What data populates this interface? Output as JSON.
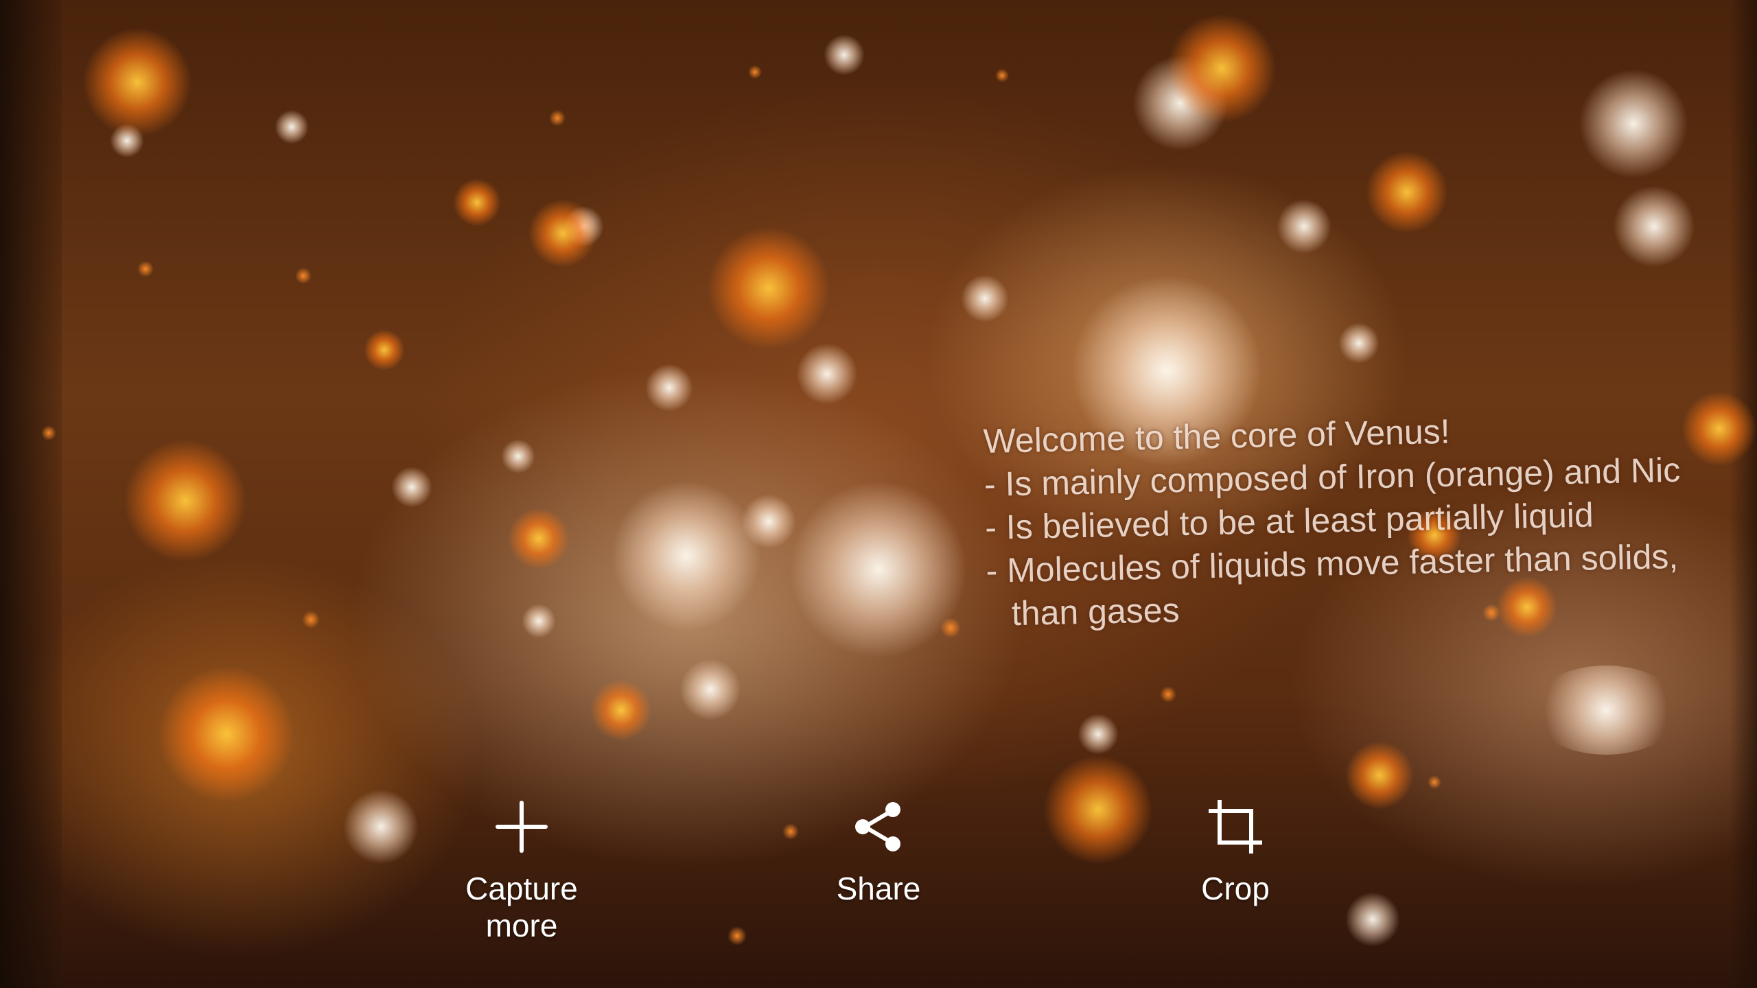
{
  "overlay": {
    "lines": [
      "Welcome to the core of Venus!",
      "- Is mainly composed of Iron (orange) and Nic",
      "- Is believed to be at least partially liquid",
      "- Molecules of liquids move faster than solids,",
      "than gases"
    ]
  },
  "toolbar": {
    "capture_label": "Capture\nmore",
    "share_label": "Share",
    "crop_label": "Crop"
  },
  "icons": {
    "capture": "plus-icon",
    "share": "share-icon",
    "crop": "crop-icon"
  },
  "colors": {
    "text": "#ffffff",
    "overlay_text": "#faebe1"
  }
}
